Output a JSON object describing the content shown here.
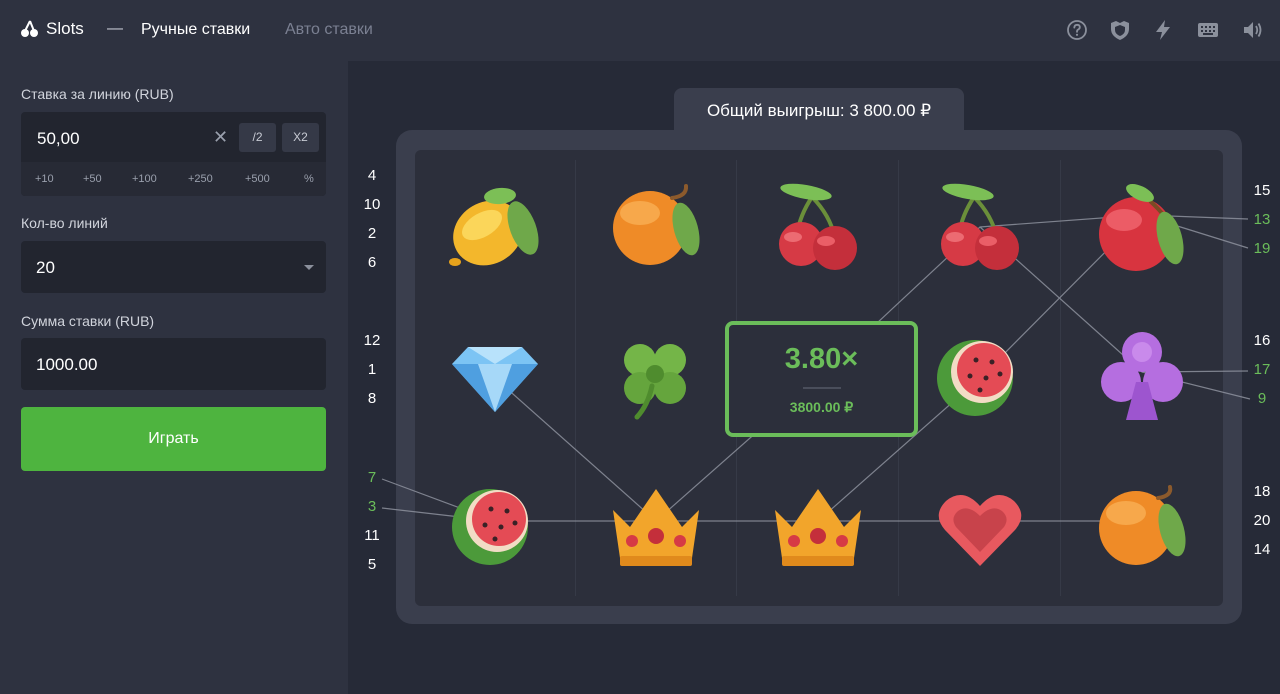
{
  "header": {
    "app_name": "Slots",
    "separator": "—",
    "tabs": [
      {
        "label": "Ручные ставки",
        "active": true
      },
      {
        "label": "Авто ставки",
        "active": false
      }
    ],
    "icons": [
      "help-icon",
      "shield-icon",
      "lightning-icon",
      "keyboard-icon",
      "speaker-icon"
    ]
  },
  "sidebar": {
    "bet_per_line_label": "Ставка за линию (RUB)",
    "bet_per_line_value": "50,00",
    "half_label": "/2",
    "double_label": "X2",
    "quick_adds": [
      "+10",
      "+50",
      "+100",
      "+250",
      "+500",
      "%"
    ],
    "lines_label": "Кол-во линий",
    "lines_value": "20",
    "total_bet_label": "Сумма ставки (RUB)",
    "total_bet_value": "1000.00",
    "play_label": "Играть"
  },
  "game": {
    "total_win_label": "Общий выигрыш: 3 800.00 ₽",
    "grid": [
      [
        "lemon",
        "orange",
        "cherry",
        "cherry",
        "apple"
      ],
      [
        "diamond",
        "clover",
        "win-box",
        "watermelon",
        "club"
      ],
      [
        "watermelon",
        "crown",
        "crown",
        "heart",
        "orange"
      ]
    ],
    "multiplier": "3.80×",
    "win_amount": "3800.00 ₽",
    "line_numbers_left": [
      {
        "n": "4",
        "win": false
      },
      {
        "n": "10",
        "win": false
      },
      {
        "n": "2",
        "win": false
      },
      {
        "n": "6",
        "win": false
      },
      {
        "n": "12",
        "win": false
      },
      {
        "n": "1",
        "win": false
      },
      {
        "n": "8",
        "win": false
      },
      {
        "n": "7",
        "win": true
      },
      {
        "n": "3",
        "win": true
      },
      {
        "n": "11",
        "win": false
      },
      {
        "n": "5",
        "win": false
      }
    ],
    "line_numbers_right": [
      {
        "n": "15",
        "win": false
      },
      {
        "n": "13",
        "win": true
      },
      {
        "n": "19",
        "win": true
      },
      {
        "n": "16",
        "win": false
      },
      {
        "n": "17",
        "win": true
      },
      {
        "n": "9",
        "win": true
      },
      {
        "n": "18",
        "win": false
      },
      {
        "n": "20",
        "win": false
      },
      {
        "n": "14",
        "win": false
      }
    ]
  },
  "colors": {
    "accent_green": "#4eb43f",
    "win_green": "#6bbd5a",
    "panel": "#2e3240",
    "background": "#262a37"
  }
}
